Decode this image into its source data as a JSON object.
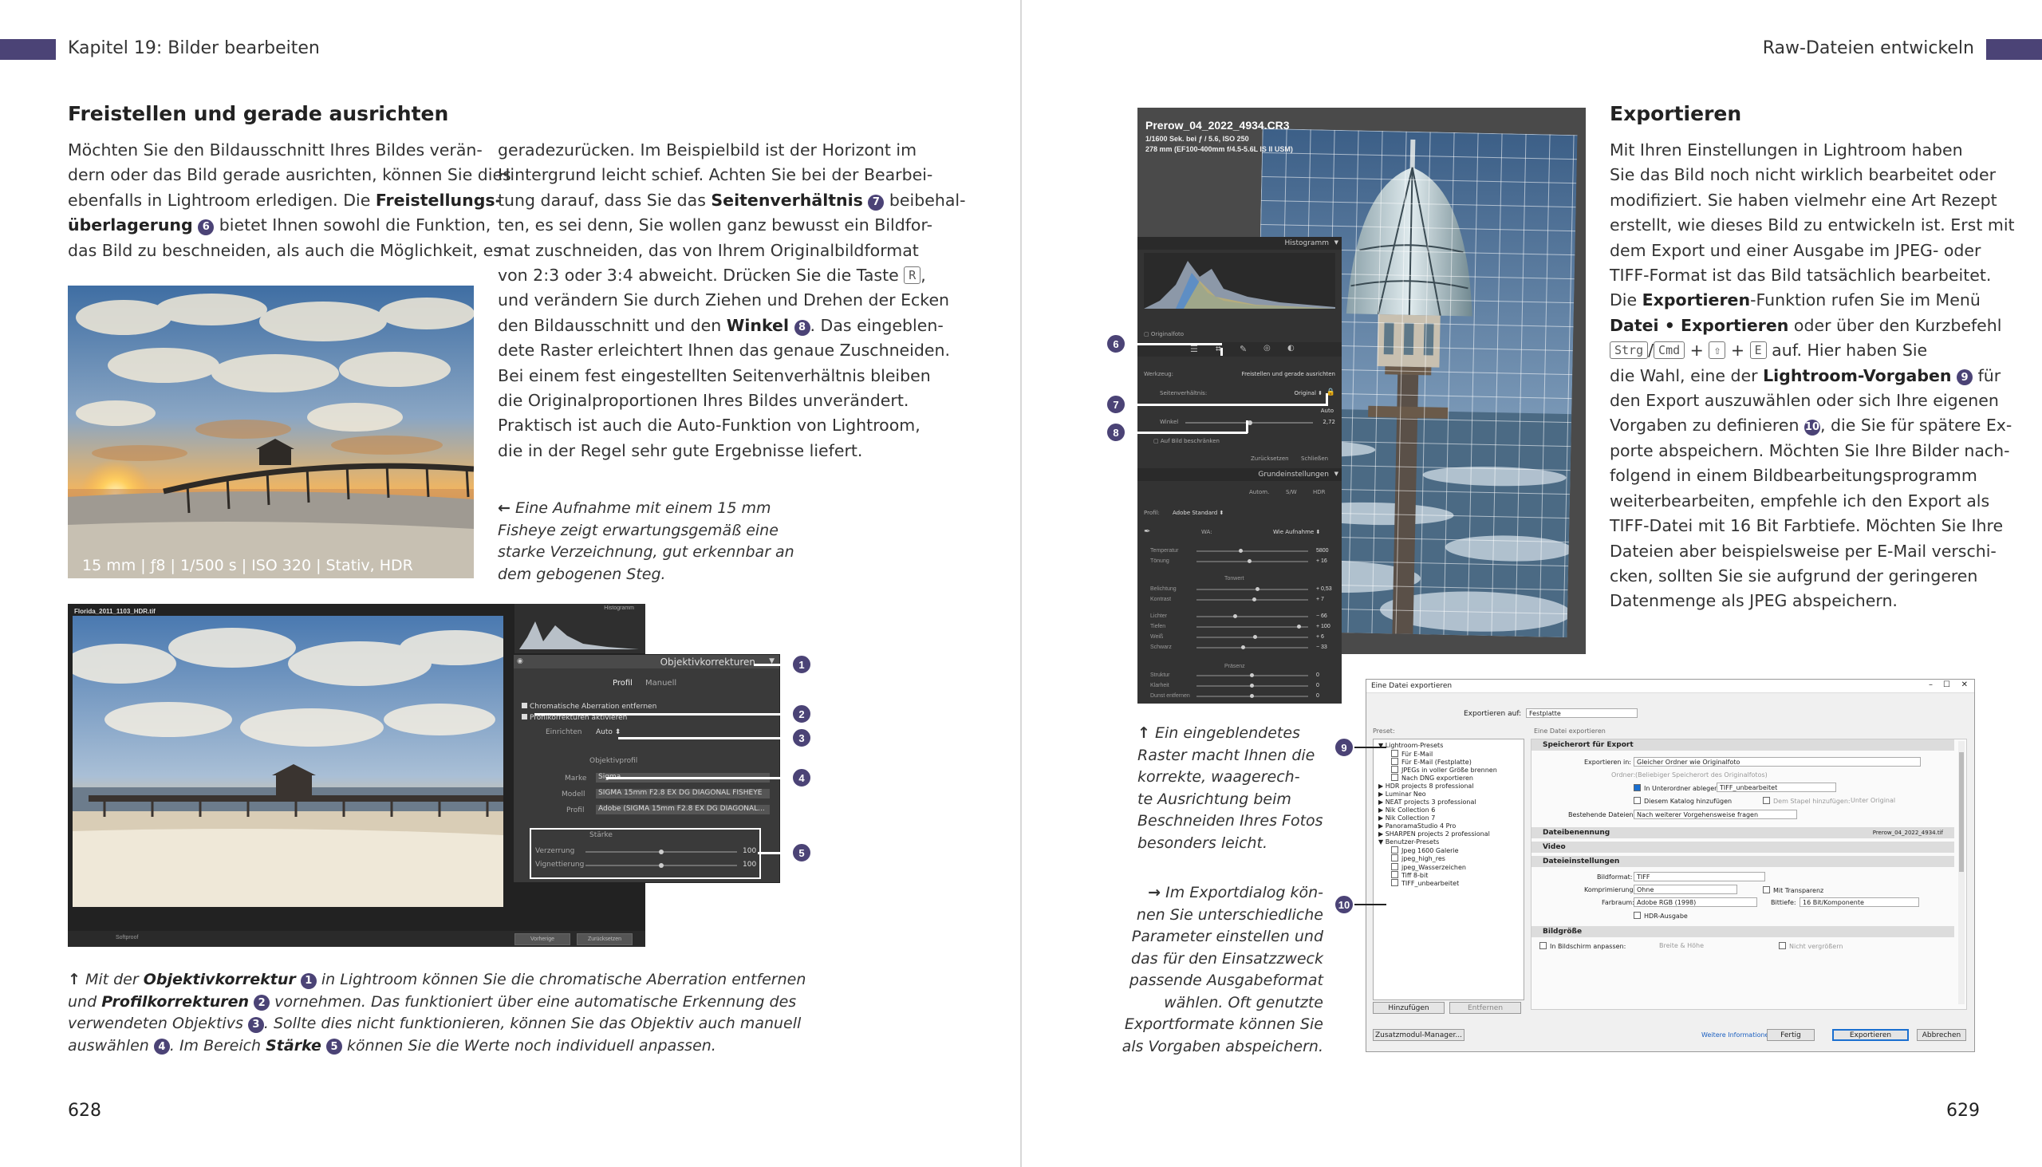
{
  "left_page": {
    "running_head": "Kapitel 19:  Bilder bearbeiten",
    "heading": "Freistellen und gerade ausrichten",
    "col1_lines": [
      [
        "Möchten Sie den Bildausschnitt Ihres Bildes verän-"
      ],
      [
        "dern oder das Bild gerade ausrichten, können Sie dies"
      ],
      [
        "ebenfalls in Lightroom erledigen. Die ",
        {
          "b": "Freistellungs-"
        }
      ],
      [
        {
          "b": "überlagerung"
        },
        " ",
        {
          "n": "6"
        },
        " bietet Ihnen sowohl die Funktion,"
      ],
      [
        "das Bild zu beschneiden, als auch die Möglichkeit, es"
      ]
    ],
    "col2_lines": [
      [
        "geradezurücken. Im Beispielbild ist der Horizont im"
      ],
      [
        "Hintergrund leicht schief. Achten Sie bei der Bearbei-"
      ],
      [
        "tung darauf, dass Sie das ",
        {
          "b": "Seitenverhältnis"
        },
        " ",
        {
          "n": "7"
        },
        " beibehal-"
      ],
      [
        "ten, es sei denn, Sie wollen ganz bewusst ein Bildfor-"
      ],
      [
        "mat zuschneiden, das von Ihrem Originalbildformat"
      ],
      [
        "von 2:3 oder 3:4 abweicht. Drücken Sie die Taste ",
        {
          "k": "R"
        },
        ","
      ],
      [
        "und verändern Sie durch Ziehen und Drehen der Ecken"
      ],
      [
        "den Bildausschnitt und den ",
        {
          "b": "Winkel"
        },
        " ",
        {
          "n": "8"
        },
        ". Das eingeblen-"
      ],
      [
        "dete Raster erleichtert Ihnen das genaue Zuschneiden."
      ],
      [
        "Bei einem fest eingestellten Seitenverhältnis bleiben"
      ],
      [
        "die Originalproportionen Ihres Bildes unverändert."
      ],
      [
        "Praktisch ist auch die Auto-Funktion von Lightroom,"
      ],
      [
        "die in der Regel sehr gute Ergebnisse liefert."
      ]
    ],
    "photo_caption": "15 mm | ƒ8 | 1/500 s | ISO 320 | Stativ, HDR",
    "side_caption_arrow": "←",
    "side_caption_lines": [
      "Eine Aufnahme mit einem 15 mm",
      "Fisheye zeigt erwartungsgemäß eine",
      "starke Verzeichnung, gut erkennbar an",
      "dem gebogenen Steg."
    ],
    "lr_panel": {
      "file": "Florida_2011_1103_HDR.tif",
      "histogram": "Histogramm",
      "title": "Objektivkorrekturen",
      "tab_profile": "Profil",
      "tab_manual": "Manuell",
      "chk_ca": "Chromatische Aberration entfernen",
      "chk_profile": "Profilkorrekturen aktivieren",
      "setup_label": "Einrichten",
      "setup_value": "Auto",
      "lens_profile": "Objektivprofil",
      "make_label": "Marke",
      "make_value": "Sigma",
      "model_label": "Modell",
      "model_value": "SIGMA 15mm F2.8 EX DG DIAGONAL FISHEYE",
      "profile_label": "Profil",
      "profile_value": "Adobe (SIGMA 15mm F2.8 EX DG DIAGONAL...",
      "amount": "Stärke",
      "distortion": "Verzerrung",
      "distortion_val": "100",
      "vignetting": "Vignettierung",
      "vignetting_val": "100",
      "btn_prev": "Vorherige",
      "btn_reset": "Zurücksetzen",
      "toolbar_label": "Softproof"
    },
    "callouts": [
      "1",
      "2",
      "3",
      "4",
      "5"
    ],
    "bottom_caption_lines": [
      [
        {
          "a": "↑"
        },
        " Mit der ",
        {
          "b": "Objektivkorrektur"
        },
        " ",
        {
          "n": "1"
        },
        " in Lightroom können Sie die chromatische Aberration entfernen"
      ],
      [
        "und ",
        {
          "b": "Profilkorrekturen"
        },
        " ",
        {
          "n": "2"
        },
        " vornehmen. Das funktioniert über eine automatische Erkennung des"
      ],
      [
        "verwendeten Objektivs ",
        {
          "n": "3"
        },
        ". Sollte dies nicht funktionieren, können Sie das Objektiv auch manuell"
      ],
      [
        "auswählen ",
        {
          "n": "4"
        },
        ". Im Bereich ",
        {
          "b": "Stärke"
        },
        " ",
        {
          "n": "5"
        },
        " können Sie die Werte noch individuell anpassen."
      ]
    ],
    "page_number": "628"
  },
  "right_page": {
    "running_head": "Raw-Dateien entwickeln",
    "heading": "Exportieren",
    "text_lines": [
      [
        "Mit Ihren Einstellungen in Lightroom haben"
      ],
      [
        "Sie das Bild noch nicht wirklich bearbeitet oder"
      ],
      [
        "modifiziert. Sie haben vielmehr eine Art Rezept"
      ],
      [
        "erstellt, wie dieses Bild zu entwickeln ist. Erst mit"
      ],
      [
        "dem Export und einer Ausgabe im JPEG- oder"
      ],
      [
        "TIFF-Format ist das Bild tatsächlich bearbeitet."
      ],
      [
        "Die ",
        {
          "b": "Exportieren"
        },
        "-Funktion rufen Sie im Menü"
      ],
      [
        {
          "b": "Datei • Exportieren"
        },
        " oder über den Kurzbefehl"
      ],
      [
        {
          "k": "Strg"
        },
        "/",
        {
          "k": "Cmd"
        },
        " + ",
        {
          "k": "⇧"
        },
        " + ",
        {
          "k": "E"
        },
        " auf. Hier haben Sie"
      ],
      [
        "die Wahl, eine der ",
        {
          "b": "Lightroom-Vorgaben"
        },
        " ",
        {
          "n": "9"
        },
        " für"
      ],
      [
        "den Export auszuwählen oder sich Ihre eigenen"
      ],
      [
        "Vorgaben zu definieren ",
        {
          "n": "10"
        },
        ", die Sie für spätere Ex-"
      ],
      [
        "porte abspeichern. Möchten Sie Ihre Bilder nach-"
      ],
      [
        "folgend in einem Bildbearbeitungsprogramm"
      ],
      [
        "weiterbearbeiten, empfehle ich den Export als"
      ],
      [
        "TIFF-Datei mit 16 Bit Farbtiefe. Möchten Sie Ihre"
      ],
      [
        "Dateien aber beispielsweise per E-Mail verschi-"
      ],
      [
        "cken, sollten Sie sie aufgrund der geringeren"
      ],
      [
        "Datenmenge als JPEG abspeichern."
      ]
    ],
    "lr_crop": {
      "file": "Prerow_04_2022_4934.CR3",
      "info1": "1/1600 Sek. bei ƒ / 5.6, ISO 250",
      "info2": "278 mm (EF100-400mm f/4.5-5.6L IS II USM)",
      "histogram": "Histogramm",
      "original_photo": "Originalfoto",
      "tool": "Werkzeug:",
      "tool_value": "Freistellen und gerade ausrichten",
      "aspect": "Seitenverhältnis:",
      "aspect_value": "Original",
      "auto": "Auto",
      "angle": "Winkel",
      "angle_value": "2,72",
      "constrain": "Auf Bild beschränken",
      "reset": "Zurücksetzen",
      "close": "Schließen",
      "basic": "Grundeinstellungen",
      "auto_btn": "Autom.",
      "bw": "S/W",
      "hdr": "HDR",
      "profile": "Profil:",
      "profile_value": "Adobe Standard",
      "wb": "WA:",
      "wb_value": "Wie Aufnahme",
      "temp": "Temperatur",
      "temp_val": "5800",
      "tint": "Tönung",
      "tint_val": "+ 16",
      "tone": "Tonwert",
      "exposure": "Belichtung",
      "exposure_val": "+ 0,53",
      "contrast": "Kontrast",
      "contrast_val": "+ 7",
      "highlights": "Lichter",
      "highlights_val": "− 66",
      "shadows": "Tiefen",
      "shadows_val": "+ 100",
      "whites": "Weiß",
      "whites_val": "+ 6",
      "blacks": "Schwarz",
      "blacks_val": "− 33",
      "presence": "Präsenz",
      "texture": "Struktur",
      "texture_val": "0",
      "clarity": "Klarheit",
      "clarity_val": "0",
      "dehaze": "Dunst entfernen",
      "dehaze_val": "0"
    },
    "callouts_crop": [
      "6",
      "7",
      "8"
    ],
    "caption1_arrow": "↑",
    "caption1_lines": [
      "Ein eingeblendetes",
      "Raster macht Ihnen die",
      "korrekte, waagerech-",
      "te Ausrichtung beim",
      "Beschneiden Ihres Fotos",
      "besonders leicht."
    ],
    "caption2_arrow": "→",
    "caption2_lines": [
      "Im Exportdialog kön-",
      "nen Sie unterschiedliche",
      "Parameter einstellen und",
      "das für den Einsatzzweck",
      "passende Ausgabeformat",
      "wählen. Oft genutzte",
      "Exportformate können Sie",
      "als Vorgaben abspeichern."
    ],
    "export_dialog": {
      "title": "Eine Datei exportieren",
      "export_to_label": "Exportieren auf:",
      "export_to_value": "Festplatte",
      "preset_label": "Preset:",
      "header_right": "Eine Datei exportieren",
      "presets": [
        {
          "label": "▼ Lightroom-Presets",
          "indent": 0
        },
        {
          "label": "Für E-Mail",
          "indent": 1
        },
        {
          "label": "Für E-Mail (Festplatte)",
          "indent": 1
        },
        {
          "label": "JPEGs in voller Größe brennen",
          "indent": 1
        },
        {
          "label": "Nach DNG exportieren",
          "indent": 1
        },
        {
          "label": "▶ HDR projects 8 professional",
          "indent": 0
        },
        {
          "label": "▶ Luminar Neo",
          "indent": 0
        },
        {
          "label": "▶ NEAT projects 3 professional",
          "indent": 0
        },
        {
          "label": "▶ Nik Collection 6",
          "indent": 0
        },
        {
          "label": "▶ Nik Collection 7",
          "indent": 0
        },
        {
          "label": "▶ PanoramaStudio 4 Pro",
          "indent": 0
        },
        {
          "label": "▶ SHARPEN projects 2 professional",
          "indent": 0
        },
        {
          "label": "▼ Benutzer-Presets",
          "indent": 0
        },
        {
          "label": "Jpeg 1600 Galerie",
          "indent": 1
        },
        {
          "label": "jpeg_high_res",
          "indent": 1
        },
        {
          "label": "jpeg_Wasserzeichen",
          "indent": 1
        },
        {
          "label": "Tiff 8-bit",
          "indent": 1
        },
        {
          "label": "TIFF_unbearbeitet",
          "indent": 1
        }
      ],
      "add": "Hinzufügen",
      "remove": "Entfernen",
      "sec_location": "Speicherort für Export",
      "export_in": "Exportieren in:",
      "export_in_value": "Gleicher Ordner wie Originalfoto",
      "folder": "Ordner:",
      "folder_value": "(Beliebiger Speicherort des Originalfotos)",
      "subfolder": "In Unterordner ablegen:",
      "subfolder_value": "TIFF_unbearbeitet",
      "add_catalog": "Diesem Katalog hinzufügen",
      "add_stack": "Dem Stapel hinzufügen:",
      "stack_value": "Unter Original",
      "existing": "Bestehende Dateien:",
      "existing_value": "Nach weiterer Vorgehensweise fragen",
      "sec_naming": "Dateibenennung",
      "naming_value": "Prerow_04_2022_4934.tif",
      "sec_video": "Video",
      "sec_settings": "Dateieinstellungen",
      "format": "Bildformat:",
      "format_value": "TIFF",
      "compress": "Komprimierung:",
      "compress_value": "Ohne",
      "transparency": "Mit Transparenz",
      "colorspace": "Farbraum:",
      "colorspace_value": "Adobe RGB (1998)",
      "bitdepth": "Bittiefe:",
      "bitdepth_value": "16 Bit/Komponente",
      "hdr": "HDR-Ausgabe",
      "sec_size": "Bildgröße",
      "resize": "In Bildschirm anpassen:",
      "resize_value": "Breite & Höhe",
      "no_enlarge": "Nicht vergrößern",
      "plugin_btn": "Zusatzmodul-Manager...",
      "more_info": "Weitere Informationen",
      "done": "Fertig",
      "export": "Exportieren",
      "cancel": "Abbrechen"
    },
    "callouts_export": [
      "9",
      "10"
    ],
    "page_number": "629"
  },
  "colors": {
    "accent": "#4b4376",
    "lr_dark": "#3c3c3c"
  }
}
